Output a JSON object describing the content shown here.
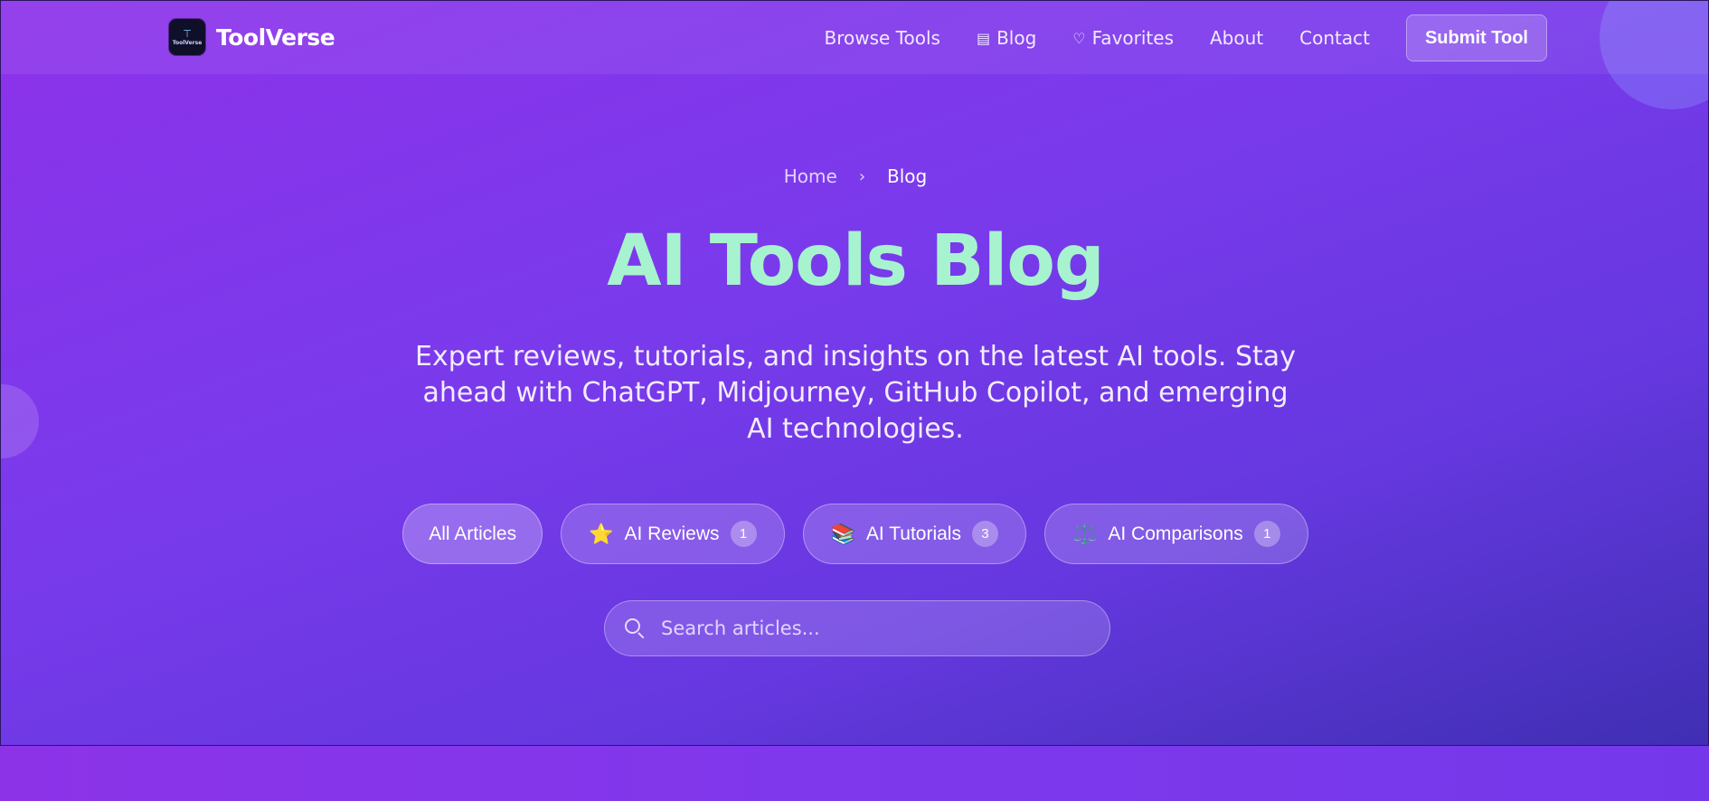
{
  "brand": {
    "name": "ToolVerse",
    "logo_text": "ToolVerse",
    "logo_glyph": "⊤"
  },
  "nav": {
    "links": [
      {
        "label": "Browse Tools",
        "icon": ""
      },
      {
        "label": "Blog",
        "icon": "newspaper-icon"
      },
      {
        "label": "Favorites",
        "icon": "heart-icon"
      },
      {
        "label": "About",
        "icon": ""
      },
      {
        "label": "Contact",
        "icon": ""
      }
    ],
    "submit_label": "Submit Tool"
  },
  "breadcrumb": {
    "home": "Home",
    "separator": "›",
    "current": "Blog"
  },
  "hero": {
    "title": "AI Tools Blog",
    "subtitle": "Expert reviews, tutorials, and insights on the latest AI tools. Stay ahead with ChatGPT, Midjourney, GitHub Copilot, and emerging AI technologies."
  },
  "filters": [
    {
      "label": "All Articles",
      "emoji": "",
      "count": null
    },
    {
      "label": "AI Reviews",
      "emoji": "⭐",
      "count": "1"
    },
    {
      "label": "AI Tutorials",
      "emoji": "📚",
      "count": "3"
    },
    {
      "label": "AI Comparisons",
      "emoji": "⚖️",
      "count": "1"
    }
  ],
  "search": {
    "placeholder": "Search articles..."
  },
  "colors": {
    "title_accent": "#a7f3d0",
    "hero_gradient_start": "#8d32ea",
    "hero_gradient_end": "#3f2fb3"
  }
}
